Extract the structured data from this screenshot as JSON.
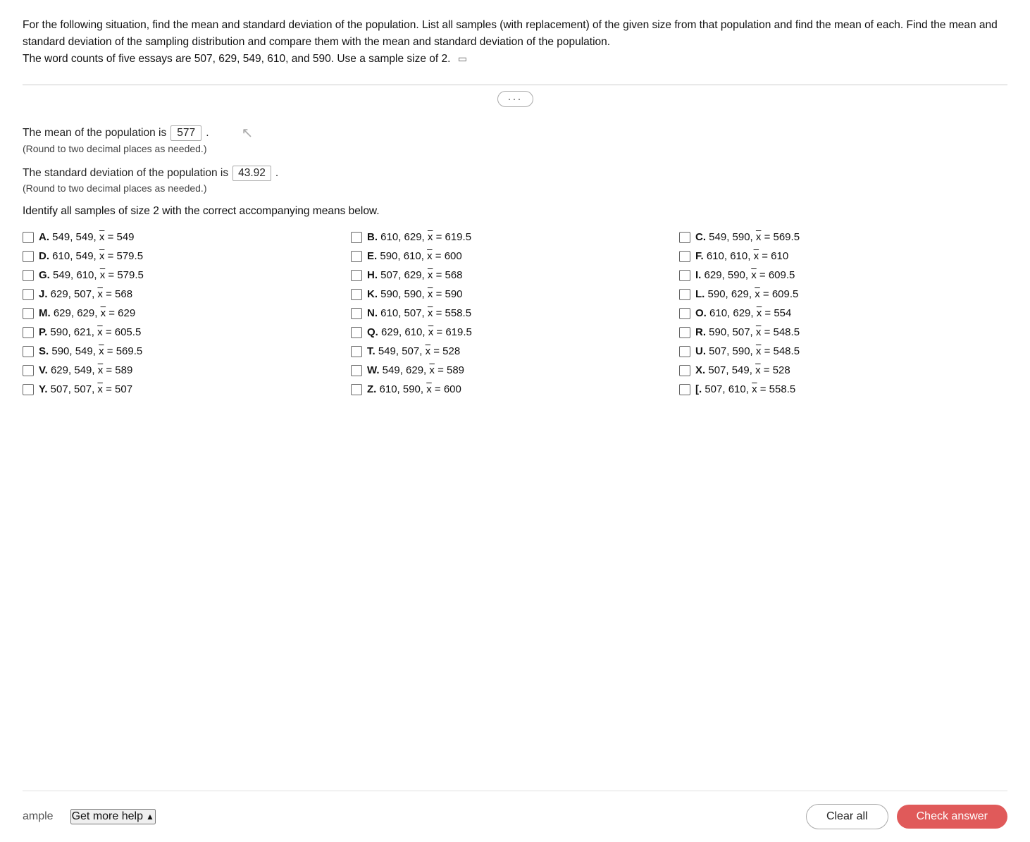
{
  "question": {
    "text": "For the following situation, find the mean and standard deviation of the population. List all samples (with replacement) of the given size from that population and find the mean of each. Find the mean and standard deviation of the sampling distribution and compare them with the mean and standard deviation of the population.",
    "subtext": "The word counts of five essays are 507, 629, 549, 610, and 590. Use a sample size of 2.",
    "expand_btn_label": "···"
  },
  "answers": {
    "mean_label": "The mean of the population is",
    "mean_value": "577",
    "mean_note": "(Round to two decimal places as needed.)",
    "stddev_label": "The standard deviation of the population is",
    "stddev_value": "43.92",
    "stddev_note": "(Round to two decimal places as needed.)",
    "identify_label": "Identify all samples of size 2 with the correct accompanying means below."
  },
  "samples": [
    {
      "letter": "A.",
      "text": "549, 549, x̄ = 549",
      "col": 0
    },
    {
      "letter": "B.",
      "text": "610, 629, x̄ = 619.5",
      "col": 1
    },
    {
      "letter": "C.",
      "text": "549, 590, x̄ = 569.5",
      "col": 2
    },
    {
      "letter": "D.",
      "text": "610, 549, x̄ = 579.5",
      "col": 0
    },
    {
      "letter": "E.",
      "text": "590, 610, x̄ = 600",
      "col": 1
    },
    {
      "letter": "F.",
      "text": "610, 610, x̄ = 610",
      "col": 2
    },
    {
      "letter": "G.",
      "text": "549, 610, x̄ = 579.5",
      "col": 0
    },
    {
      "letter": "H.",
      "text": "507, 629, x̄ = 568",
      "col": 1
    },
    {
      "letter": "I.",
      "text": "629, 590, x̄ = 609.5",
      "col": 2
    },
    {
      "letter": "J.",
      "text": "629, 507, x̄ = 568",
      "col": 0
    },
    {
      "letter": "K.",
      "text": "590, 590, x̄ = 590",
      "col": 1
    },
    {
      "letter": "L.",
      "text": "590, 629, x̄ = 609.5",
      "col": 2
    },
    {
      "letter": "M.",
      "text": "629, 629, x̄ = 629",
      "col": 0
    },
    {
      "letter": "N.",
      "text": "610, 507, x̄ = 558.5",
      "col": 1
    },
    {
      "letter": "O.",
      "text": "610, 629, x̄ = 554",
      "col": 2
    },
    {
      "letter": "P.",
      "text": "590, 621, x̄ = 605.5",
      "col": 0
    },
    {
      "letter": "Q.",
      "text": "629, 610, x̄ = 619.5",
      "col": 1
    },
    {
      "letter": "R.",
      "text": "590, 507, x̄ = 548.5",
      "col": 2
    },
    {
      "letter": "S.",
      "text": "590, 549, x̄ = 569.5",
      "col": 0
    },
    {
      "letter": "T.",
      "text": "549, 507, x̄ = 528",
      "col": 1
    },
    {
      "letter": "U.",
      "text": "507, 590, x̄ = 548.5",
      "col": 2
    },
    {
      "letter": "V.",
      "text": "629, 549, x̄ = 589",
      "col": 0
    },
    {
      "letter": "W.",
      "text": "549, 629, x̄ = 589",
      "col": 1
    },
    {
      "letter": "X.",
      "text": "507, 549, x̄ = 528",
      "col": 2
    },
    {
      "letter": "Y.",
      "text": "507, 507, x̄ = 507",
      "col": 0
    },
    {
      "letter": "Z.",
      "text": "610, 590, x̄ = 600",
      "col": 1
    },
    {
      "letter": "[.",
      "text": "507, 610, x̄ = 558.5",
      "col": 2
    }
  ],
  "footer": {
    "example_label": "ample",
    "get_more_help_label": "Get more help",
    "get_more_help_icon": "▲",
    "clear_all_label": "Clear all",
    "check_answer_label": "Check answer"
  }
}
